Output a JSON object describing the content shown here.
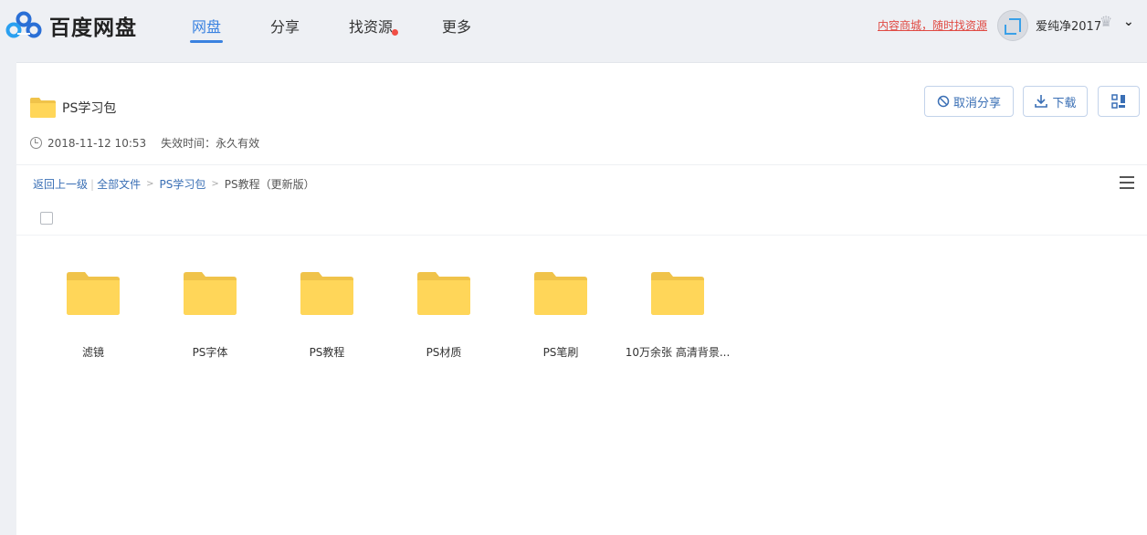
{
  "brand": {
    "name": "百度网盘",
    "accent": "#3a82e0"
  },
  "nav": [
    {
      "label": "网盘",
      "active": true
    },
    {
      "label": "分享",
      "active": false
    },
    {
      "label": "找资源",
      "active": false,
      "dot": true
    },
    {
      "label": "更多",
      "active": false
    }
  ],
  "header": {
    "promo": "内容商城，随时找资源",
    "username": "爱纯净2017"
  },
  "share": {
    "title": "PS学习包",
    "date": "2018-11-12 10:53",
    "expire": "失效时间：永久有效",
    "cancel_label": "取消分享",
    "download_label": "下载"
  },
  "breadcrumb": {
    "back": "返回上一级",
    "all": "全部文件",
    "parent": "PS学习包",
    "sep": ">",
    "current": "PS教程（更新版）"
  },
  "files": [
    {
      "name": "滤镜",
      "icon": "folder-icon"
    },
    {
      "name": "PS字体",
      "icon": "folder-icon"
    },
    {
      "name": "PS教程",
      "icon": "folder-icon"
    },
    {
      "name": "PS材质",
      "icon": "folder-icon"
    },
    {
      "name": "PS笔刷",
      "icon": "folder-icon"
    },
    {
      "name": "10万余张 高清背景...",
      "icon": "folder-icon"
    }
  ],
  "colors": {
    "folder": "#ffd659",
    "folder_tab": "#f0c34a",
    "link": "#3a6fb5",
    "promo": "#e04a43"
  }
}
